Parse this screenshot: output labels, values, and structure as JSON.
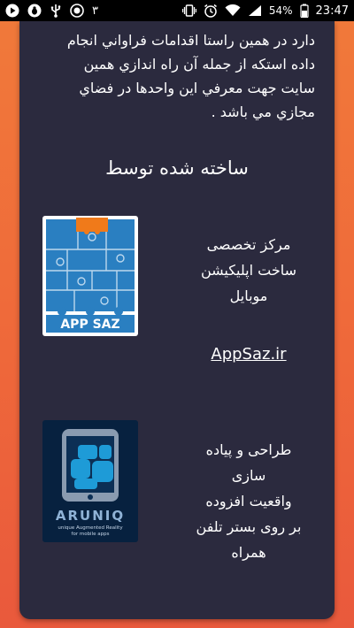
{
  "status_bar": {
    "notification_count": "۳",
    "battery_percent": "54%",
    "time": "23:47",
    "icons": [
      "play-icon",
      "bug-icon",
      "usb-icon",
      "record-icon",
      "vibrate-icon",
      "alarm-icon",
      "wifi-icon",
      "signal-icon",
      "battery-icon"
    ]
  },
  "about": {
    "paragraph_lines": [
      "دارد در همين راستا اقدامات فراواني انجام",
      "داده استكه از جمله آن راه اندازي همين",
      "سايت جهت معرفي اين واحدها در فضاي",
      "مجازي مي باشد ."
    ]
  },
  "built_by": {
    "title": "ساخته شده توسط",
    "companies": [
      {
        "logo_text": "APP SAZ",
        "description_lines": [
          "مرکز تخصصی",
          "ساخت اپلیکیشن",
          "موبایل"
        ],
        "link_text": "AppSaz.ir"
      },
      {
        "logo_text": "ARUNIQ",
        "logo_tagline_1": "unique Augmented Reality",
        "logo_tagline_2": "for mobile apps",
        "description_lines": [
          "طراحی و پیاده",
          "سازی",
          "واقعیت افزوده",
          "بر روی بستر تلفن",
          "همراه"
        ]
      }
    ]
  },
  "colors": {
    "card_background": "#2b2a3e",
    "outer_background": "#ef6a3a",
    "appsaz_blue": "#2a7fc1",
    "appsaz_orange": "#f07a1a",
    "aruniq_navy": "#07213f",
    "aruniq_blue": "#1e9bd7"
  }
}
